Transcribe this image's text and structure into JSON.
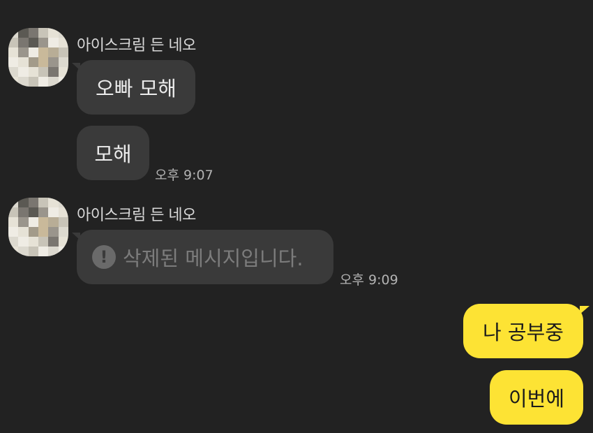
{
  "messages": [
    {
      "sender": "아이스크림 든 네오",
      "text": "오빠 모해"
    },
    {
      "text": "모해",
      "time": "오후 9:07"
    },
    {
      "sender": "아이스크림 든 네오",
      "text": "삭제된 메시지입니다.",
      "time": "오후 9:09",
      "icon": "exclamation-circle-icon",
      "icon_glyph": "!"
    },
    {
      "text": "나 공부중"
    },
    {
      "text": "이번에"
    }
  ],
  "avatar": {
    "icon": "pixelated-profile-avatar"
  },
  "colors": {
    "background": "#222222",
    "incoming_bubble": "#3a3a3a",
    "outgoing_bubble": "#fde334",
    "deleted_text": "#7c7c7c",
    "timestamp": "#b3b3b3"
  }
}
